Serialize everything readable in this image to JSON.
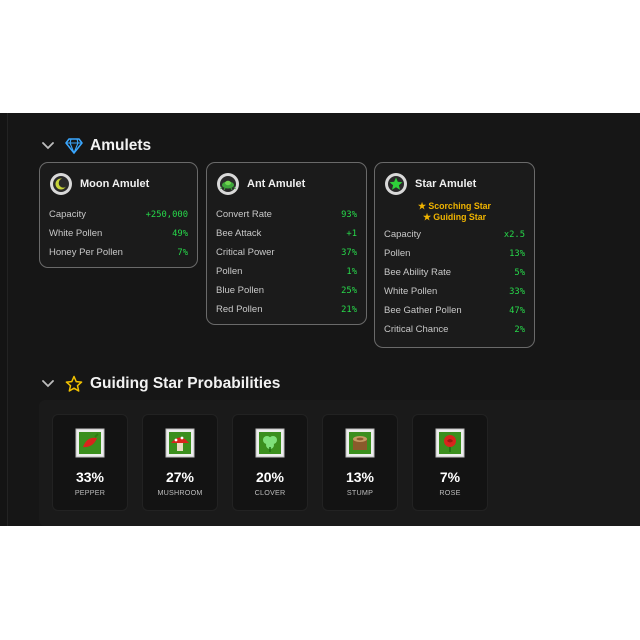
{
  "amulets_section": {
    "title": "Amulets",
    "cards": [
      {
        "title": "Moon Amulet",
        "icon": "moon-icon",
        "stats": [
          {
            "label": "Capacity",
            "value": "+250,000"
          },
          {
            "label": "White Pollen",
            "value": "49%"
          },
          {
            "label": "Honey Per Pollen",
            "value": "7%"
          }
        ]
      },
      {
        "title": "Ant Amulet",
        "icon": "ant-icon",
        "stats": [
          {
            "label": "Convert Rate",
            "value": "93%"
          },
          {
            "label": "Bee Attack",
            "value": "+1"
          },
          {
            "label": "Critical Power",
            "value": "37%"
          },
          {
            "label": "Pollen",
            "value": "1%"
          },
          {
            "label": "Blue Pollen",
            "value": "25%"
          },
          {
            "label": "Red Pollen",
            "value": "21%"
          }
        ]
      },
      {
        "title": "Star Amulet",
        "icon": "star-icon",
        "passives": [
          "★ Scorching Star",
          "★ Guiding Star"
        ],
        "stats": [
          {
            "label": "Capacity",
            "value": "x2.5"
          },
          {
            "label": "Pollen",
            "value": "13%"
          },
          {
            "label": "Bee Ability Rate",
            "value": "5%"
          },
          {
            "label": "White Pollen",
            "value": "33%"
          },
          {
            "label": "Bee Gather Pollen",
            "value": "47%"
          },
          {
            "label": "Critical Chance",
            "value": "2%"
          }
        ]
      }
    ]
  },
  "guiding_star_section": {
    "title": "Guiding Star Probabilities",
    "fields": [
      {
        "percent": "33%",
        "name": "PEPPER",
        "icon": "pepper-icon"
      },
      {
        "percent": "27%",
        "name": "MUSHROOM",
        "icon": "mushroom-icon"
      },
      {
        "percent": "20%",
        "name": "CLOVER",
        "icon": "clover-icon"
      },
      {
        "percent": "13%",
        "name": "STUMP",
        "icon": "stump-icon"
      },
      {
        "percent": "7%",
        "name": "ROSE",
        "icon": "rose-icon"
      }
    ]
  },
  "colors": {
    "background": "#161616",
    "card_border": "#6a6a6a",
    "stat_value": "#27d84a",
    "passive_gold": "#f0b400",
    "gem_blue": "#3aa7ff",
    "star_gold": "#f2c200"
  }
}
